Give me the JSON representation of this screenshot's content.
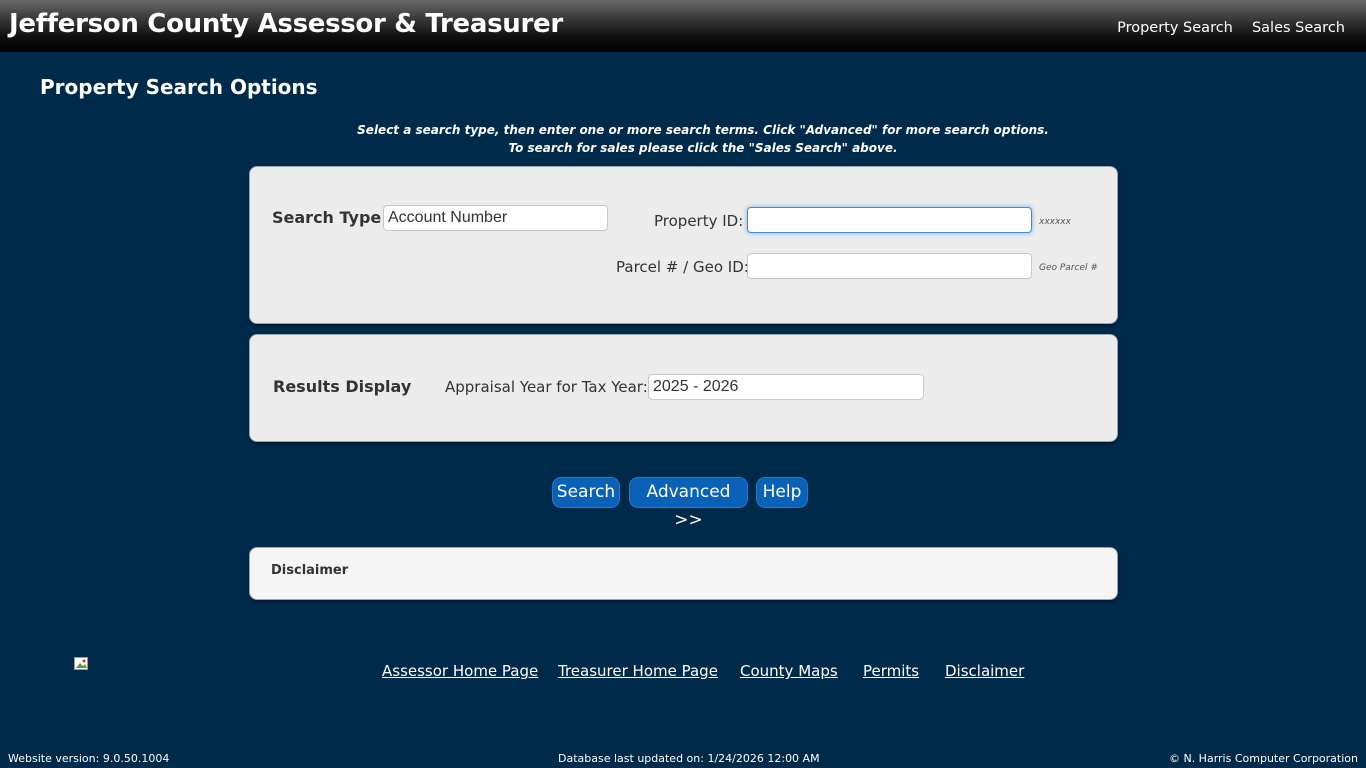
{
  "header": {
    "title": "Jefferson County Assessor & Treasurer",
    "nav": [
      "Property Search",
      "Sales Search"
    ]
  },
  "page": {
    "title": "Property Search Options",
    "instructions_line1": "Select a search type, then enter one or more search terms. Click \"Advanced\" for more search options.",
    "instructions_line2": "To search for sales please click the \"Sales Search\" above."
  },
  "search_panel": {
    "search_type_label": "Search Type:",
    "search_type_value": "Account Number",
    "property_id_label": "Property ID:",
    "property_id_value": "",
    "property_id_hint": "xxxxxx",
    "parcel_label": "Parcel # / Geo ID:",
    "parcel_value": "",
    "parcel_hint": "Geo Parcel #"
  },
  "results_panel": {
    "title": "Results Display",
    "year_label": "Appraisal Year for Tax Year:",
    "year_value": "2025 - 2026"
  },
  "buttons": {
    "search": "Search",
    "advanced": "Advanced >>",
    "help": "Help"
  },
  "disclaimer_panel": {
    "title": "Disclaimer"
  },
  "footer": {
    "links": [
      "Assessor Home Page",
      "Treasurer Home Page",
      "County Maps",
      "Permits",
      "Disclaimer"
    ],
    "website_version": "Website version: 9.0.50.1004",
    "db_updated": "Database last updated on: 1/24/2026 12:00 AM",
    "copyright": "© N. Harris Computer Corporation"
  },
  "colors": {
    "background": "#002a4a",
    "button": "#0a62b8",
    "panel": "#ececec"
  }
}
